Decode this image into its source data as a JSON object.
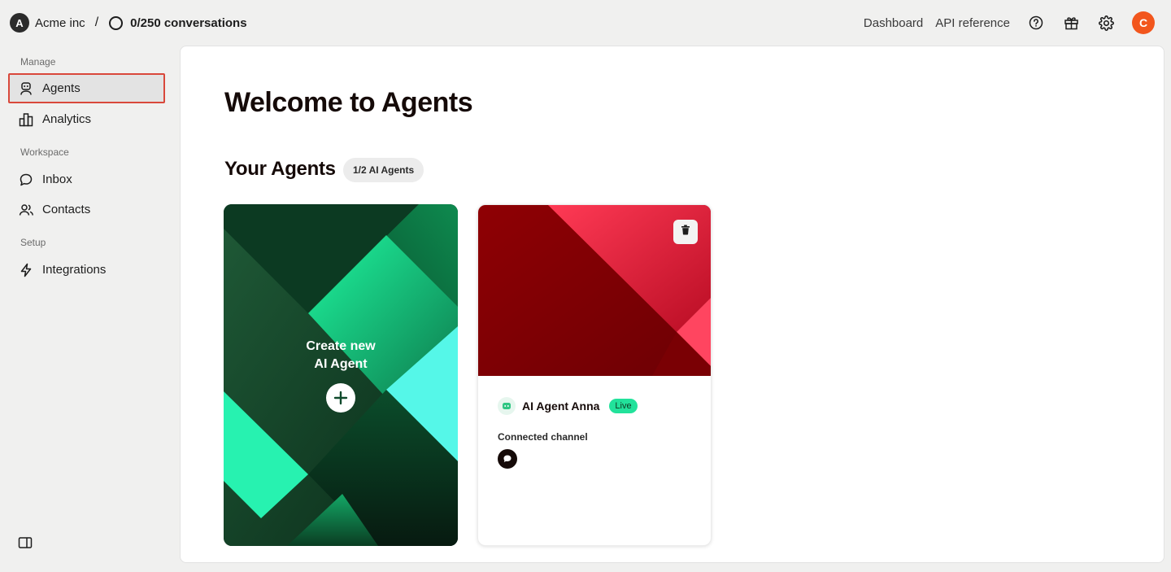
{
  "org": {
    "initial": "A",
    "name": "Acme inc",
    "separator": "/"
  },
  "conversations": {
    "label": "0/250 conversations"
  },
  "header": {
    "links": [
      "Dashboard",
      "API reference"
    ],
    "icons": [
      "help-icon",
      "gift-icon",
      "settings-icon"
    ],
    "user_initial": "C"
  },
  "sidebar": {
    "sections": [
      {
        "label": "Manage",
        "items": [
          {
            "label": "Agents",
            "icon": "robot-icon",
            "active": true
          },
          {
            "label": "Analytics",
            "icon": "bar-chart-icon"
          }
        ]
      },
      {
        "label": "Workspace",
        "items": [
          {
            "label": "Inbox",
            "icon": "chat-bubble-icon"
          },
          {
            "label": "Contacts",
            "icon": "users-icon"
          }
        ]
      },
      {
        "label": "Setup",
        "items": [
          {
            "label": "Integrations",
            "icon": "bolt-icon"
          }
        ]
      }
    ],
    "collapse_icon": "sidebar-toggle-icon"
  },
  "main": {
    "title": "Welcome to Agents",
    "agents_heading": "Your Agents",
    "agents_count": "1/2 AI Agents",
    "create_card": {
      "line1": "Create new",
      "line2": "AI Agent"
    },
    "agent": {
      "name": "AI Agent Anna",
      "status": "Live",
      "connected_label": "Connected channel",
      "channel_icon": "chat-channel-icon"
    }
  },
  "colors": {
    "accent": "#f2561d",
    "active_border": "#d9483b",
    "live": "#22e29b",
    "create_card_dark": "#0b2416",
    "agent_banner_red": "#8a0006"
  }
}
